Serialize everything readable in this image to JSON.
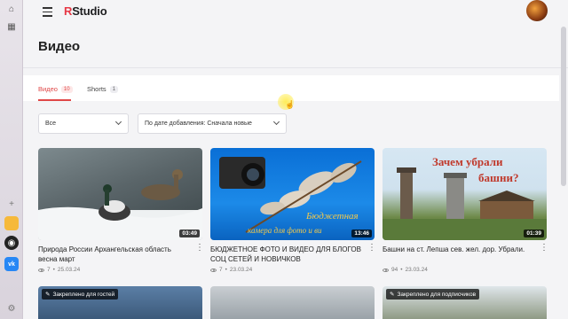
{
  "app": {
    "logo_prefix": "R",
    "logo_suffix": "Studio"
  },
  "page": {
    "title": "Видео"
  },
  "tabs": [
    {
      "label": "Видео",
      "count": "10",
      "active": true
    },
    {
      "label": "Shorts",
      "count": "1",
      "active": false
    }
  ],
  "filters": {
    "category": "Все",
    "sort": "По дате добавления: Сначала новые"
  },
  "videos": [
    {
      "title": "Природа России Архангельская область весна март",
      "duration": "03:49",
      "views": "7",
      "date": "25.03.24"
    },
    {
      "title": "БЮДЖЕТНОЕ ФОТО И ВИДЕО ДЛЯ БЛОГОВ СОЦ СЕТЕЙ И НОВИЧКОВ",
      "duration": "13:46",
      "views": "7",
      "date": "23.03.24",
      "thumb_caption_1": "Бюджетная",
      "thumb_caption_2": "камера для фото и ви"
    },
    {
      "title": "Башни на ст. Лепша сев. жел. дор. Убрали.",
      "duration": "01:39",
      "views": "94",
      "date": "23.03.24",
      "thumb_caption_1": "Зачем убрали",
      "thumb_caption_2": "башни?"
    }
  ],
  "pinned": [
    {
      "label": "Закреплено для гостей"
    },
    {
      "label": "Закреплено для подписчиков"
    }
  ],
  "colors": {
    "accent": "#e04747",
    "background": "#f4f4f6"
  },
  "icons": {
    "menu": "hamburger-icon",
    "more": "vertical-dots-icon",
    "views": "eye-icon",
    "pin": "pin-icon"
  }
}
